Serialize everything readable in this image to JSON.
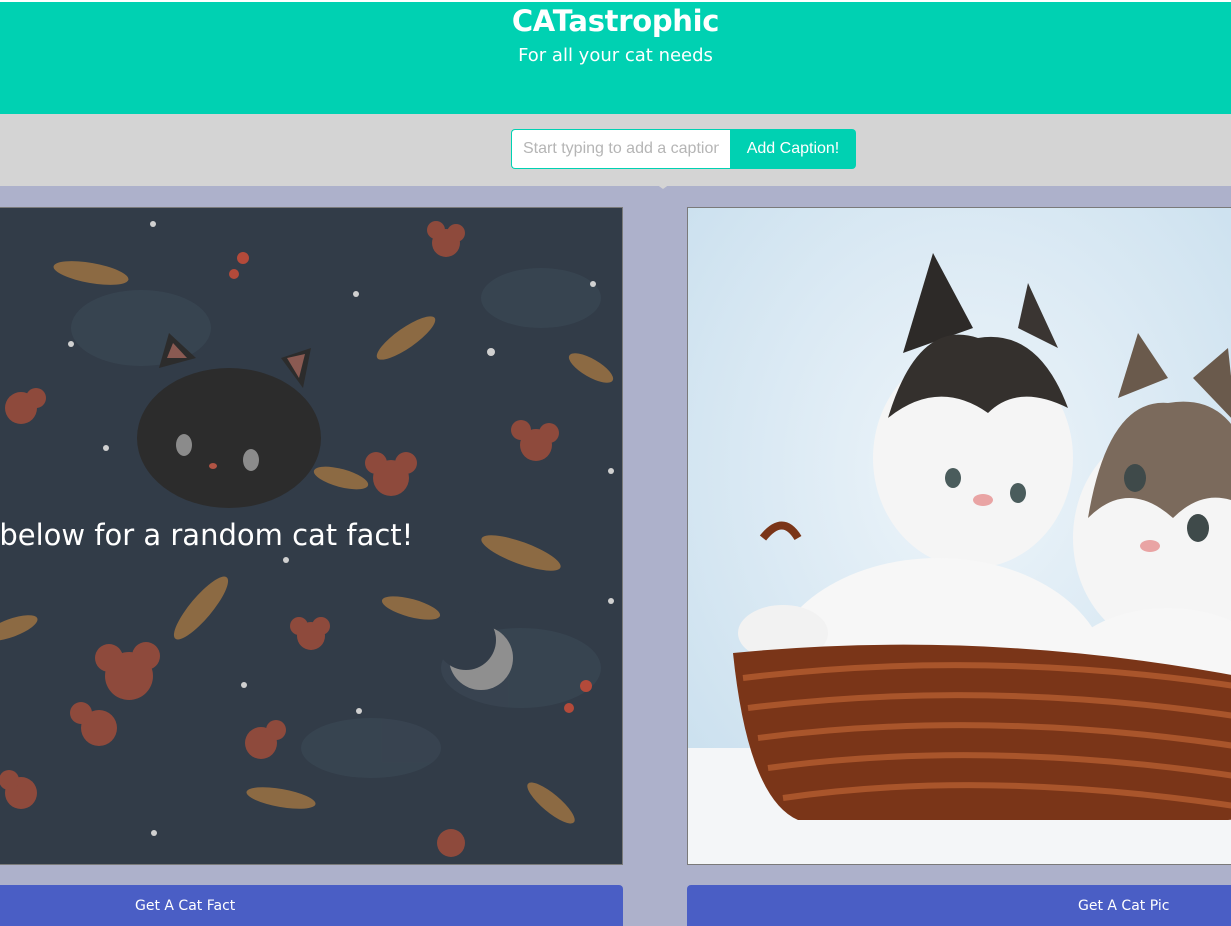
{
  "header": {
    "title": "CATastrophic",
    "subtitle": "For all your cat needs"
  },
  "caption": {
    "placeholder": "Start typing to add a caption",
    "button_label": "Add Caption!"
  },
  "fact_panel": {
    "text": "Click below for a random cat fact!",
    "background_icons": [
      "cat-face-icon",
      "flower-icon",
      "leaf-icon",
      "star-icon",
      "moon-icon",
      "berry-icon"
    ]
  },
  "pic_panel": {
    "image": "kittens-in-basket-image"
  },
  "buttons": {
    "fact_label": "Get A Cat Fact",
    "pic_label": "Get A Cat Pic"
  },
  "colors": {
    "primary": "#00d1b2",
    "button_blue": "#4a5ec5",
    "page_background": "#adb1cb",
    "caption_bar": "#d4d4d4",
    "fact_panel_background": "#323c48"
  }
}
